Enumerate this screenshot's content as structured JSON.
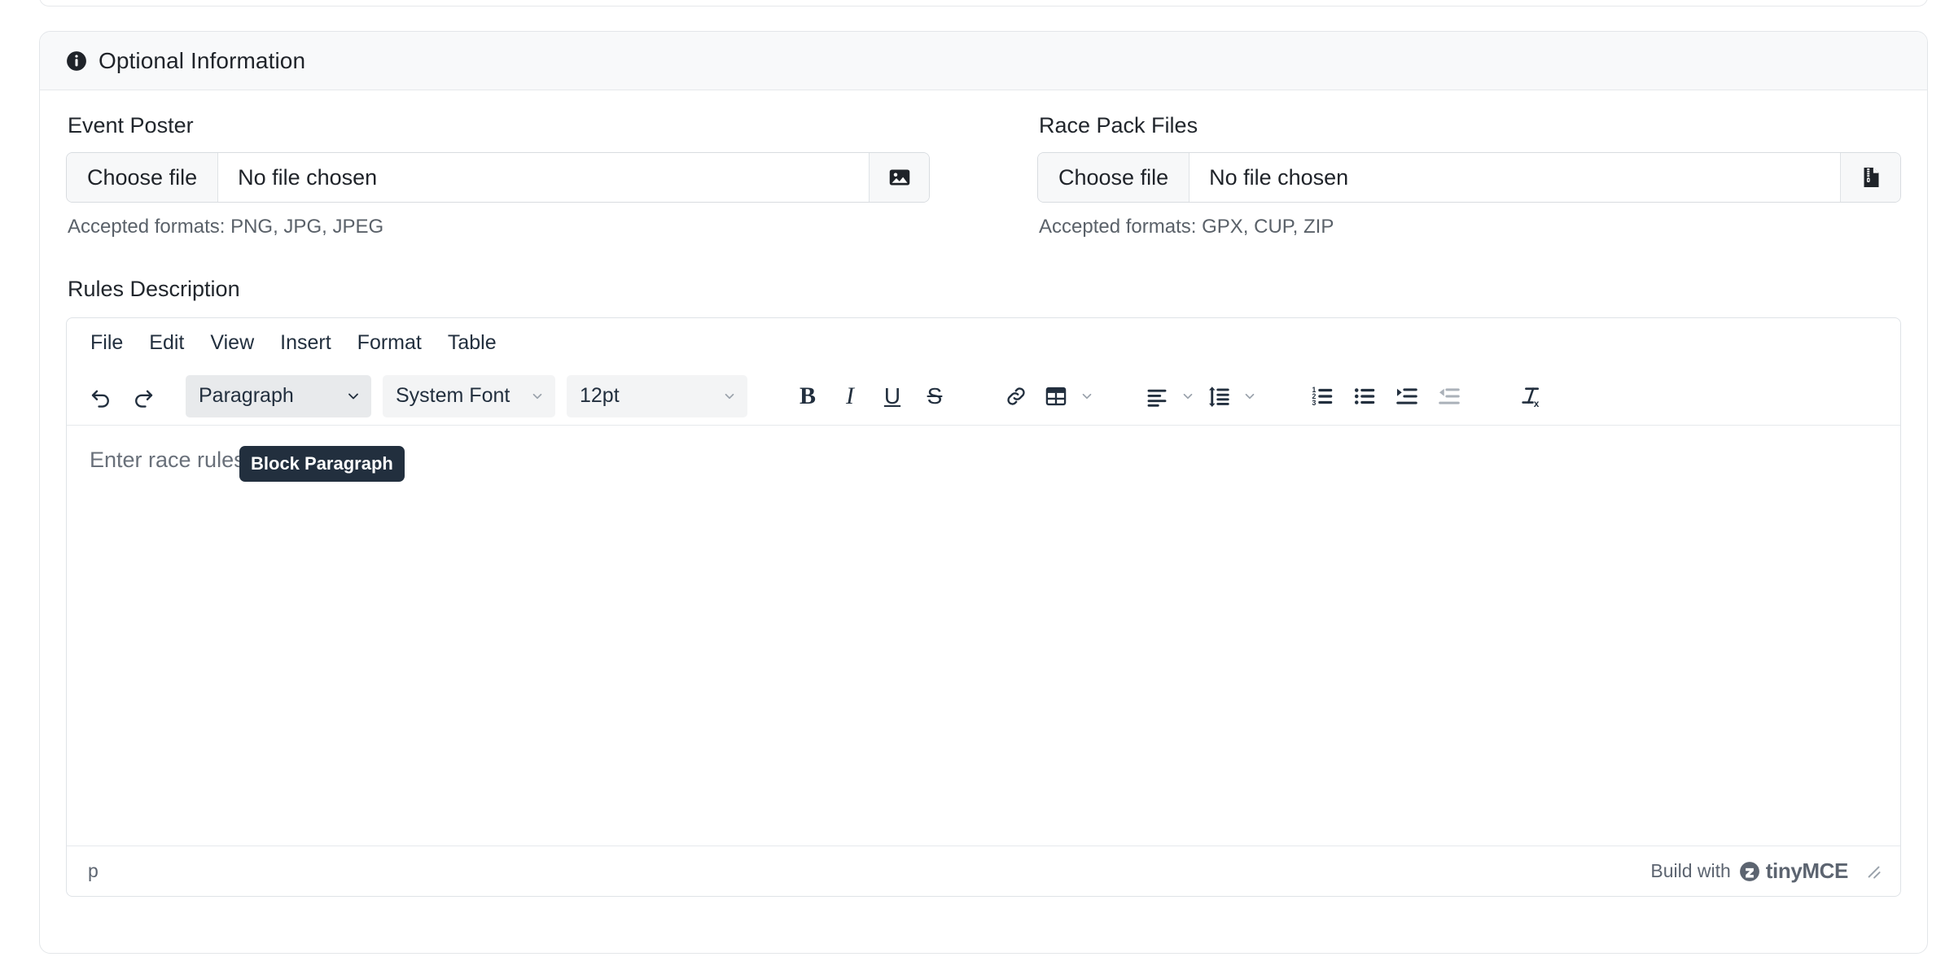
{
  "card": {
    "header": {
      "icon": "info-circle-icon",
      "title": "Optional Information"
    }
  },
  "fields": {
    "event_poster": {
      "label": "Event Poster",
      "choose_label": "Choose file",
      "file_status": "No file chosen",
      "icon": "image-icon",
      "help": "Accepted formats: PNG, JPG, JPEG"
    },
    "race_pack_files": {
      "label": "Race Pack Files",
      "choose_label": "Choose file",
      "file_status": "No file chosen",
      "icon": "zip-file-icon",
      "help": "Accepted formats: GPX, CUP, ZIP"
    },
    "rules_description": {
      "label": "Rules Description"
    }
  },
  "editor": {
    "menubar": [
      {
        "label": "File"
      },
      {
        "label": "Edit"
      },
      {
        "label": "View"
      },
      {
        "label": "Insert"
      },
      {
        "label": "Format"
      },
      {
        "label": "Table"
      }
    ],
    "toolbar": {
      "undo": "undo-icon",
      "redo": "redo-icon",
      "block_format": "Paragraph",
      "font_family": "System Font",
      "font_size": "12pt",
      "bold": "B",
      "italic": "I",
      "underline": "U",
      "strikethrough": "S",
      "link": "link-icon",
      "table": "table-icon",
      "align": "align-left-icon",
      "line_height": "line-height-icon",
      "numbered_list": "numbered-list-icon",
      "bullet_list": "bullet-list-icon",
      "increase_indent": "increase-indent-icon",
      "decrease_indent": "decrease-indent-icon",
      "clear_formatting": "clear-formatting-icon"
    },
    "tooltip": "Block Paragraph",
    "placeholder": "Enter race rules and description",
    "statusbar": {
      "element_path": "p",
      "branding_prefix": "Build with",
      "branding_name": "tinyMCE"
    }
  },
  "colors": {
    "header_bg": "#f8f9fa",
    "card_border": "#e3e6e9",
    "text_primary": "#1f2329",
    "text_muted": "#5a6169",
    "toolbar_select_bg": "#f3f4f5",
    "toolbar_select_active_bg": "#e8eaec",
    "tooltip_bg": "#222f3e",
    "icon_color": "#222f3e"
  }
}
